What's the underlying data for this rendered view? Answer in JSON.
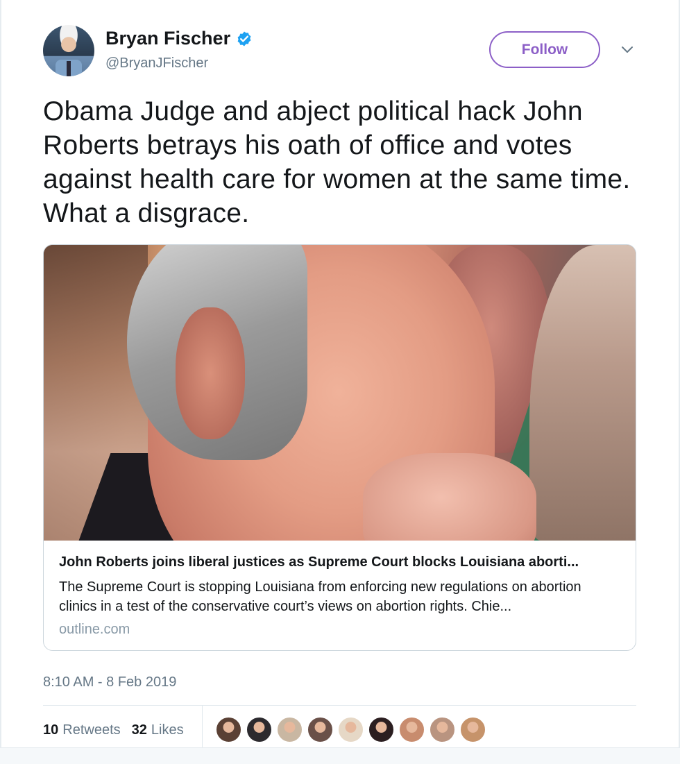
{
  "author": {
    "display_name": "Bryan Fischer",
    "handle": "@BryanJFischer",
    "verified": true,
    "avatar_icon": "user-avatar"
  },
  "follow_button": {
    "label": "Follow",
    "color": "#8c5fc7"
  },
  "menu_icon": "chevron-down-icon",
  "tweet": {
    "text": "Obama Judge and abject political hack John Roberts betrays his oath of office and votes against health care for women at the same time. What a disgrace."
  },
  "card": {
    "image_description_icon": "photo",
    "title": "John Roberts joins liberal justices as Supreme Court blocks Louisiana aborti...",
    "description": "The Supreme Court is stopping Louisiana from enforcing new regulations on abortion clinics in a test of the conservative court’s views on abortion rights. Chie...",
    "domain": "outline.com"
  },
  "timestamp": "8:10 AM - 8 Feb 2019",
  "stats": {
    "retweets_count": "10",
    "retweets_label": "Retweets",
    "likes_count": "32",
    "likes_label": "Likes"
  },
  "liker_avatars": [
    "#5a4034",
    "#2c2a2e",
    "#c9b7a2",
    "#6a5048",
    "#e6d8c6",
    "#2b1e20",
    "#c88c6e",
    "#b99480",
    "#c6936a"
  ],
  "colors": {
    "verified": "#1da1f2",
    "secondary_text": "#657786",
    "border": "#e1e8ed"
  }
}
